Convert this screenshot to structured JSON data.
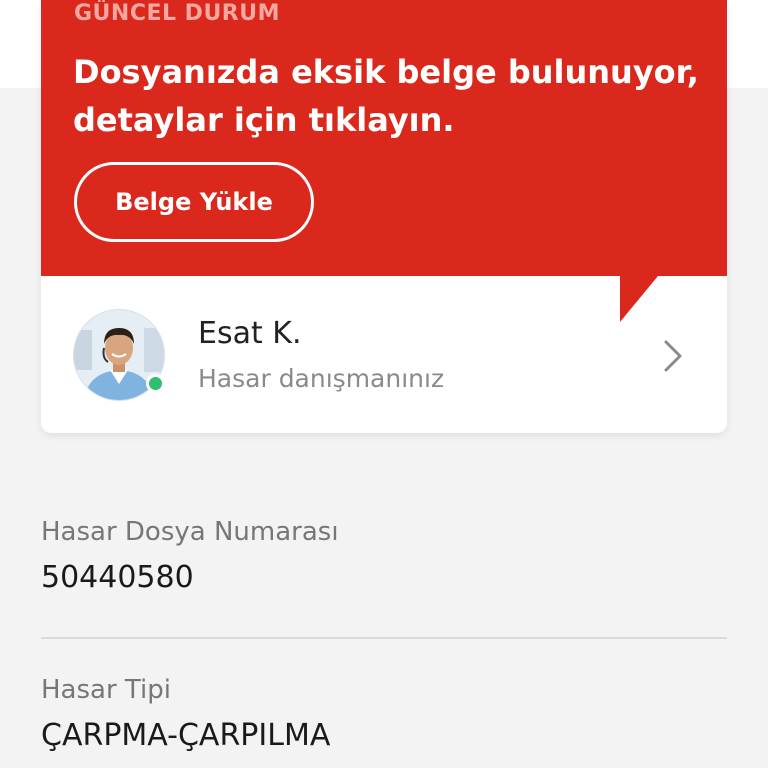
{
  "status": {
    "label": "GÜNCEL DURUM",
    "message": "Dosyanızda eksik belge bulunuyor, detaylar için tıklayın.",
    "upload_button": "Belge Yükle",
    "color": "#da291c"
  },
  "advisor": {
    "name": "Esat K.",
    "role": "Hasar danışmanınız",
    "online": true,
    "avatar_icon": "person-avatar",
    "chevron_icon": "chevron-right-icon"
  },
  "claim": {
    "number_label": "Hasar Dosya Numarası",
    "number_value": "50440580",
    "type_label": "Hasar Tipi",
    "type_value": "ÇARPMA-ÇARPILMA"
  }
}
